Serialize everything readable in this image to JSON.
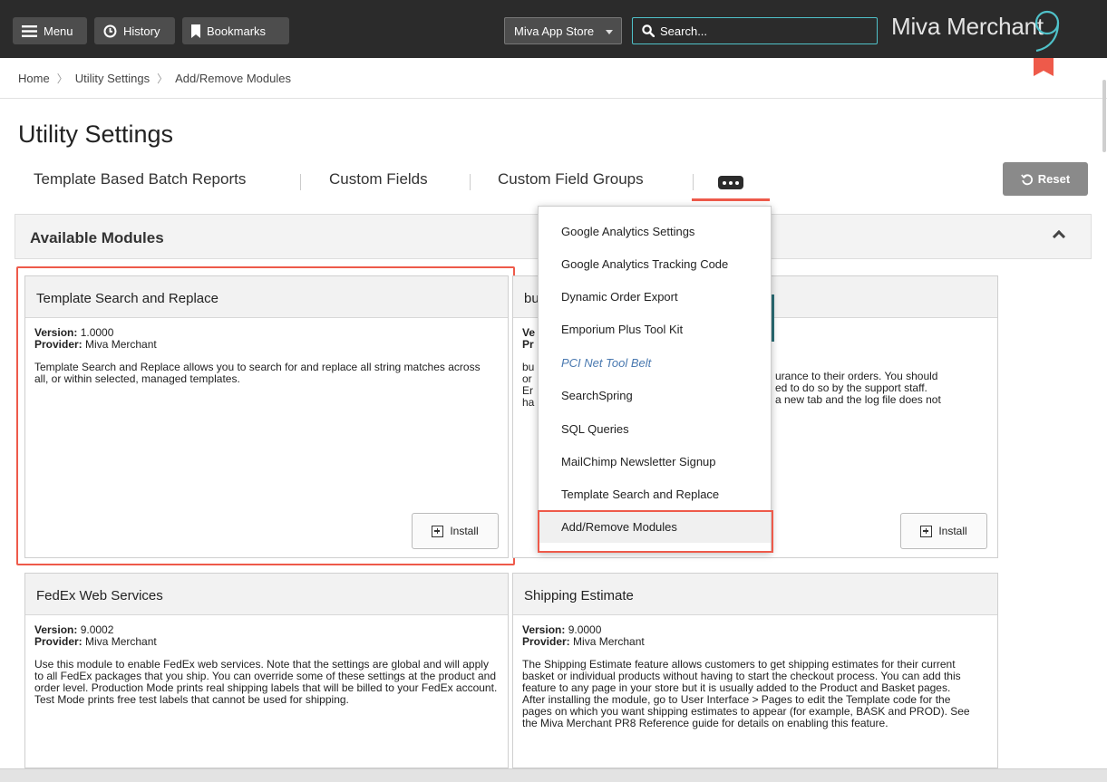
{
  "topbar": {
    "menu_label": "Menu",
    "history_label": "History",
    "bookmarks_label": "Bookmarks",
    "store_select_value": "Miva App Store",
    "search_placeholder": "Search...",
    "logo_text": "Miva Merchant"
  },
  "breadcrumb": {
    "items": [
      "Home",
      "Utility Settings",
      "Add/Remove Modules"
    ]
  },
  "page": {
    "title": "Utility Settings"
  },
  "tabs": [
    "Template Based Batch Reports",
    "Custom Fields",
    "Custom Field Groups"
  ],
  "reset_label": "Reset",
  "panel": {
    "title": "Available Modules"
  },
  "dropdown": {
    "items": [
      "Google Analytics Settings",
      "Google Analytics Tracking Code",
      "Dynamic Order Export",
      "Emporium Plus Tool Kit",
      "PCI Net Tool Belt",
      "SearchSpring",
      "SQL Queries",
      "MailChimp Newsletter Signup",
      "Template Search and Replace",
      "Add/Remove Modules"
    ]
  },
  "cards": [
    {
      "title": "Template Search and Replace",
      "version_label": "Version:",
      "version": "1.0000",
      "provider_label": "Provider:",
      "provider": "Miva Merchant",
      "description": "Template Search and Replace allows you to search for and replace all string matches across all, or within selected, managed templates.",
      "install_label": "Install"
    },
    {
      "title": "bu",
      "version_label": "Ve",
      "provider_label": "Pr",
      "desc_lines": [
        "bu",
        "or",
        "Er",
        "ha"
      ],
      "desc_right": [
        "urance to their orders. You should",
        "ed to do so by the support staff.",
        "a new tab and the log file does not"
      ],
      "install_label": "Install"
    },
    {
      "title": "FedEx Web Services",
      "version_label": "Version:",
      "version": "9.0002",
      "provider_label": "Provider:",
      "provider": "Miva Merchant",
      "description": "Use this module to enable FedEx web services. Note that the settings are global and will apply to all FedEx packages that you ship. You can override some of these settings at the product and order level. Production Mode prints real shipping labels that will be billed to your FedEx account. Test Mode prints free test labels that cannot be used for shipping."
    },
    {
      "title": "Shipping Estimate",
      "version_label": "Version:",
      "version": "9.0000",
      "provider_label": "Provider:",
      "provider": "Miva Merchant",
      "description": "The Shipping Estimate feature allows customers to get shipping estimates for their current basket or individual products without having to start the checkout process. You can add this feature to any page in your store but it is usually added to the Product and Basket pages. After installing the module, go to User Interface > Pages to edit the Template code for the pages on which you want shipping estimates to appear (for example, BASK and PROD). See the Miva Merchant PR8 Reference guide for details on enabling this feature."
    }
  ],
  "colors": {
    "topbar": "#2b2b2b",
    "accent": "#ee5a4a",
    "search_border": "#4fc1c9",
    "link_italic": "#4a79b0"
  }
}
